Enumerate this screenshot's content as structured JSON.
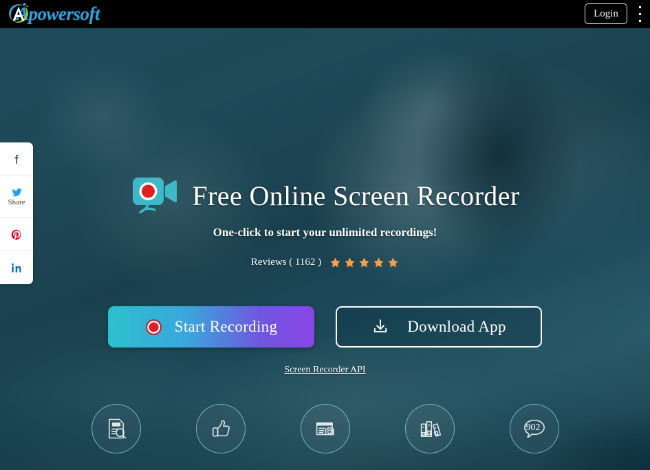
{
  "topbar": {
    "logo_text": "Apowersoft",
    "logo_icon": "apowersoft-logo-icon",
    "login_label": "Login",
    "menu_icon": "kebab-menu-icon"
  },
  "social": {
    "share_label": "Share",
    "items": [
      {
        "name": "facebook",
        "icon": "facebook-icon",
        "color": "#3b5998"
      },
      {
        "name": "twitter",
        "icon": "twitter-icon",
        "color": "#1da1f2"
      },
      {
        "name": "pinterest",
        "icon": "pinterest-icon",
        "color": "#e60023"
      },
      {
        "name": "linkedin",
        "icon": "linkedin-icon",
        "color": "#0a66c2"
      }
    ]
  },
  "hero": {
    "camera_icon": "video-camera-record-icon",
    "title": "Free Online Screen Recorder",
    "subtitle": "One-click to start your unlimited recordings!",
    "reviews_label": "Reviews ( 1162 )",
    "reviews_count": "1162",
    "stars": 5,
    "star_color": "#f5a14b",
    "start_button": {
      "label": "Start Recording",
      "icon": "record-dot-icon",
      "gradient_from": "#2cc0cf",
      "gradient_to": "#8a45e6"
    },
    "download_button": {
      "label": "Download App",
      "icon": "download-arrow-icon"
    },
    "api_link": "Screen Recorder API"
  },
  "features": [
    {
      "name": "document-search",
      "icon": "document-magnifier-icon",
      "badge": ""
    },
    {
      "name": "thumbs-up",
      "icon": "thumbs-up-icon",
      "badge": ""
    },
    {
      "name": "screenshot",
      "icon": "document-camera-icon",
      "badge": ""
    },
    {
      "name": "library",
      "icon": "books-icon",
      "badge": ""
    },
    {
      "name": "comments",
      "icon": "speech-bubble-icon",
      "badge": "902"
    }
  ]
}
